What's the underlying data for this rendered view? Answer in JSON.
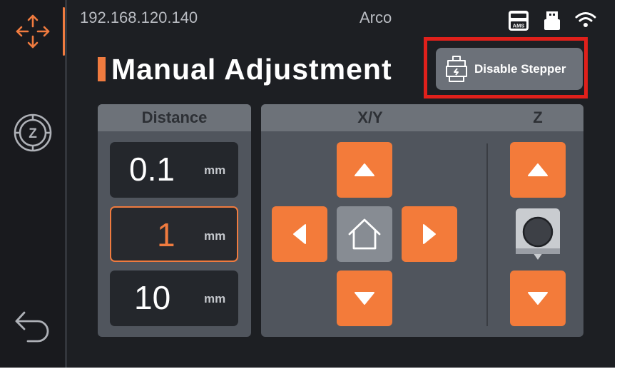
{
  "status_bar": {
    "ip_address": "192.168.120.140",
    "device_name": "Arco",
    "ams_label": "AMS",
    "icons": [
      "ams-icon",
      "usb-drive-icon",
      "wifi-icon"
    ]
  },
  "sidebar": {
    "items": [
      {
        "icon": "move-axes-icon",
        "active": true
      },
      {
        "icon": "z-offset-icon",
        "active": false
      },
      {
        "icon": "back-icon",
        "active": false
      }
    ]
  },
  "page": {
    "title": "Manual Adjustment",
    "disable_stepper_label": "Disable Stepper"
  },
  "distance": {
    "header": "Distance",
    "options": [
      {
        "value": "0.1",
        "unit": "mm"
      },
      {
        "value": "1",
        "unit": "mm"
      },
      {
        "value": "10",
        "unit": "mm"
      }
    ],
    "selected": "1"
  },
  "movement": {
    "xy_header": "X/Y",
    "z_header": "Z"
  },
  "colors": {
    "accent": "#f07b3f",
    "highlight": "#e0201b",
    "background": "#1d1f23",
    "panel": "#50555d"
  }
}
